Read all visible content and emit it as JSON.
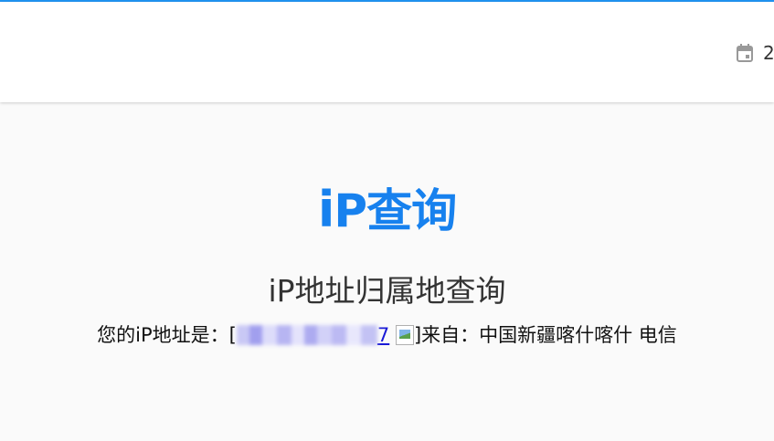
{
  "header": {
    "date_text": "2",
    "calendar_icon": "calendar-icon"
  },
  "main": {
    "logo": {
      "i": "i",
      "rest": "P查询"
    },
    "subtitle": "iP地址归属地查询",
    "info": {
      "prefix": "您的iP地址是：[",
      "ip_suffix": "7",
      "after_image": "]来自：中国新疆喀什喀什 电信"
    }
  },
  "colors": {
    "accent_line": "#1f93f2",
    "logo": "#1781ee",
    "link": "#1a1ad6"
  }
}
